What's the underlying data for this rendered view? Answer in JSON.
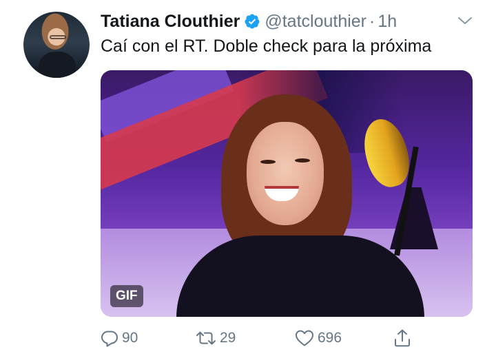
{
  "tweet": {
    "author": {
      "display_name": "Tatiana Clouthier",
      "handle": "@tatclouthier",
      "verified": true
    },
    "separator": "·",
    "timestamp": "1h",
    "text": "Caí con el RT. Doble check para la próxima",
    "media": {
      "badge": "GIF"
    },
    "actions": {
      "reply_count": "90",
      "retweet_count": "29",
      "like_count": "696"
    }
  },
  "colors": {
    "text": "#14171a",
    "secondary": "#657786",
    "verified": "#1da1f2"
  },
  "icons": {
    "verified": "verified-badge-icon",
    "more": "chevron-down-icon",
    "reply": "reply-icon",
    "retweet": "retweet-icon",
    "like": "heart-icon",
    "share": "share-icon"
  }
}
